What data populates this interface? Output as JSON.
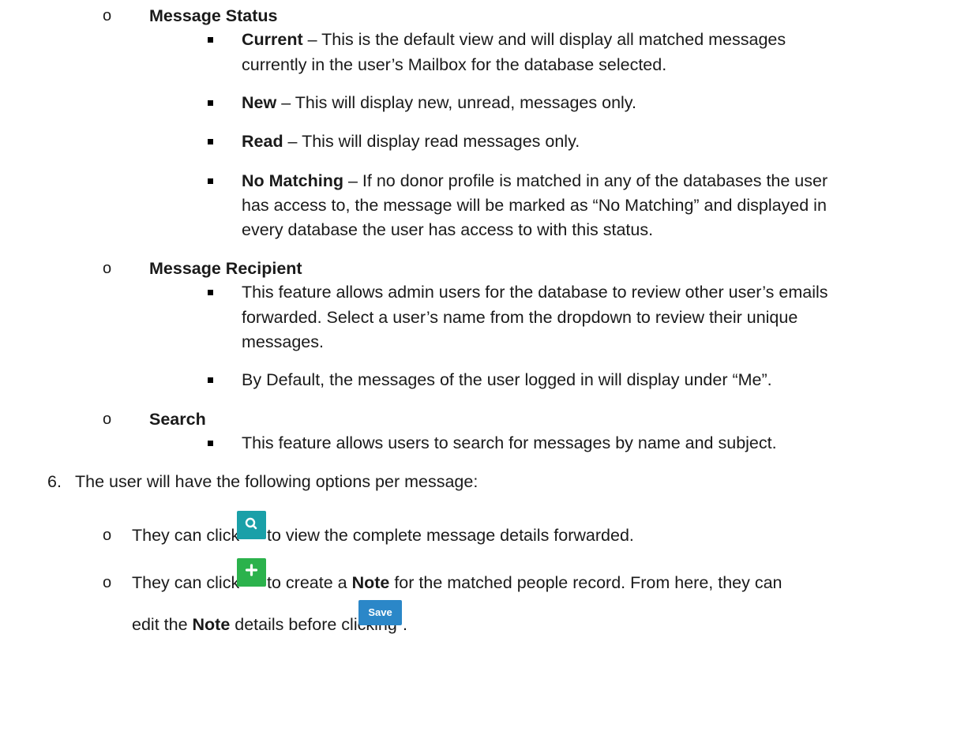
{
  "sections": [
    {
      "marker": "o",
      "heading": "Message Status",
      "items": [
        {
          "term": "Current",
          "lines": [
            " – This is the default view and will display all matched messages",
            "currently in the user’s Mailbox for the database selected."
          ]
        },
        {
          "term": "New",
          "lines": [
            " – This will display new, unread, messages only."
          ]
        },
        {
          "term": "Read",
          "lines": [
            " – This will display read messages only."
          ]
        },
        {
          "term": "No Matching",
          "lines": [
            " – If no donor profile is matched in any of the databases the user",
            "has access to, the message will be marked as “No Matching” and displayed in",
            "every database the user has access to with this status."
          ]
        }
      ]
    },
    {
      "marker": "o",
      "heading": "Message Recipient",
      "items": [
        {
          "term": "",
          "lines": [
            "This feature allows admin users for the database to review other user’s emails",
            "forwarded. Select a user’s name from the dropdown to review their unique",
            "messages."
          ]
        },
        {
          "term": "",
          "lines": [
            "By Default, the messages of the user logged in will display under “Me”."
          ]
        }
      ]
    },
    {
      "marker": "o",
      "heading": "Search",
      "items": [
        {
          "term": "",
          "lines": [
            "This feature allows users to search for messages by name and subject."
          ]
        }
      ]
    }
  ],
  "step": {
    "number": "6.",
    "text": "The user will have the following options per message:"
  },
  "options": [
    {
      "marker": "o",
      "before": "They can click",
      "icon": "search-icon",
      "after": " to view the complete message details forwarded."
    },
    {
      "marker": "o",
      "before": "They can click",
      "icon": "plus-icon",
      "after_pre": " to create a ",
      "after_bold": "Note",
      "after_post": " for the matched people record. From here, they can",
      "line2_pre": "edit the ",
      "line2_bold": "Note",
      "line2_post": " details before clicking",
      "line2_end": "."
    }
  ],
  "save_button": {
    "label": "Save"
  },
  "colors": {
    "search_button": "#1aa0a8",
    "add_button": "#2bb24c",
    "save_button": "#2b87c8"
  }
}
